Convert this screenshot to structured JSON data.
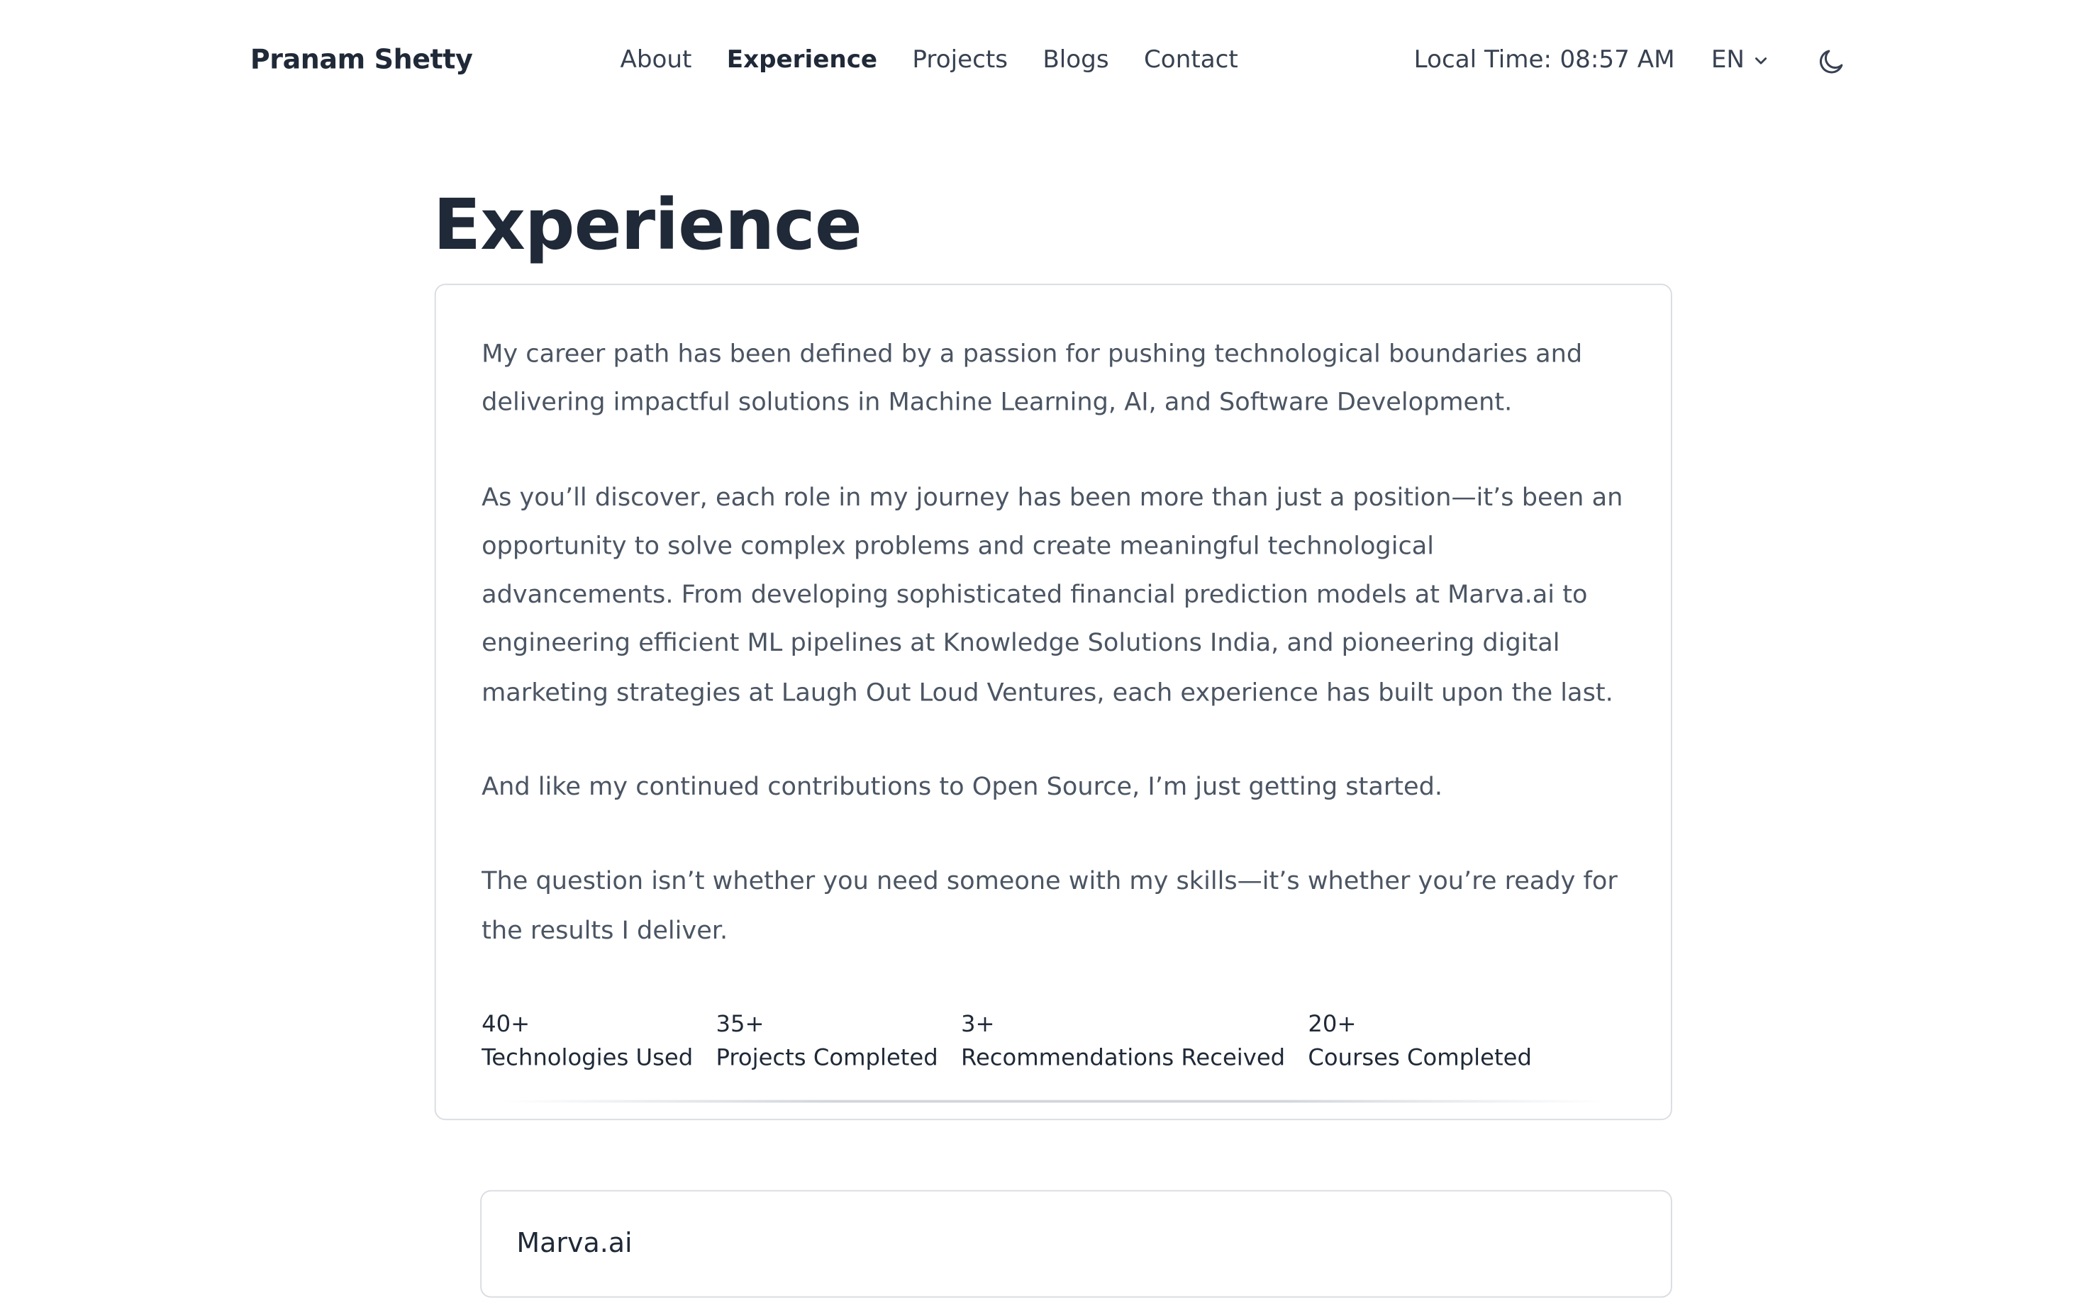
{
  "header": {
    "brand": "Pranam Shetty",
    "nav": [
      "About",
      "Experience",
      "Projects",
      "Blogs",
      "Contact"
    ],
    "active_nav": "Experience",
    "local_time_label": "Local Time:",
    "local_time_value": "08:57 AM",
    "language": "EN",
    "theme_icon": "moon-icon"
  },
  "main": {
    "title": "Experience",
    "intro_paragraphs": [
      "My career path has been defined by a passion for pushing technological boundaries and delivering impactful solutions in Machine Learning, AI, and Software Development.",
      "As you’ll discover, each role in my journey has been more than just a position—it’s been an opportunity to solve complex problems and create meaningful technological advancements. From developing sophisticated financial prediction models at Marva.ai to engineering efficient ML pipelines at Knowledge Solutions India, and pioneering digital marketing strategies at Laugh Out Loud Ventures, each experience has built upon the last.",
      "And like my continued contributions to Open Source, I’m just getting started.",
      "The question isn’t whether you need someone with my skills—it’s whether you’re ready for the results I deliver."
    ],
    "stats": [
      {
        "value": "40+",
        "label": "Technologies Used"
      },
      {
        "value": "35+",
        "label": "Projects Completed"
      },
      {
        "value": "3+",
        "label": "Recommendations Received"
      },
      {
        "value": "20+",
        "label": "Courses Completed"
      }
    ],
    "first_experience": {
      "company": "Marva.ai"
    }
  },
  "colors": {
    "text_primary": "#1f2937",
    "text_body": "#4b5563",
    "border": "#d9dce1",
    "background": "#ffffff"
  }
}
